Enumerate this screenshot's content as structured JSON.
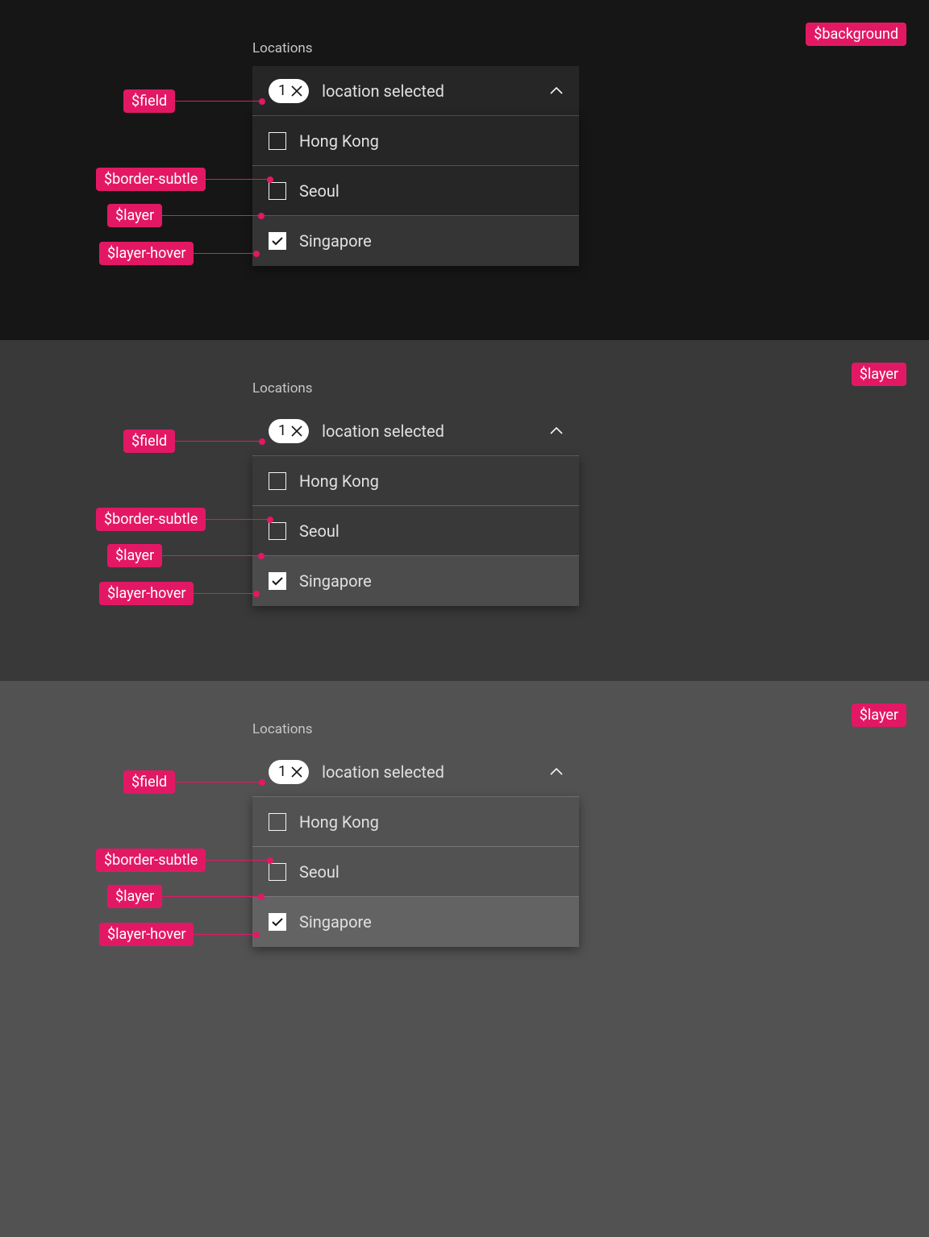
{
  "corner_tags": {
    "panel1": "$background",
    "panel2": "$layer",
    "panel3": "$layer"
  },
  "annotations": {
    "field": "$field",
    "border_subtle": "$border-subtle",
    "layer": "$layer",
    "layer_hover": "$layer-hover"
  },
  "multiselect": {
    "label": "Locations",
    "selected_count": "1",
    "field_text": "location selected",
    "options": [
      {
        "label": "Hong Kong",
        "checked": false
      },
      {
        "label": "Seoul",
        "checked": false
      },
      {
        "label": "Singapore",
        "checked": true
      }
    ]
  }
}
